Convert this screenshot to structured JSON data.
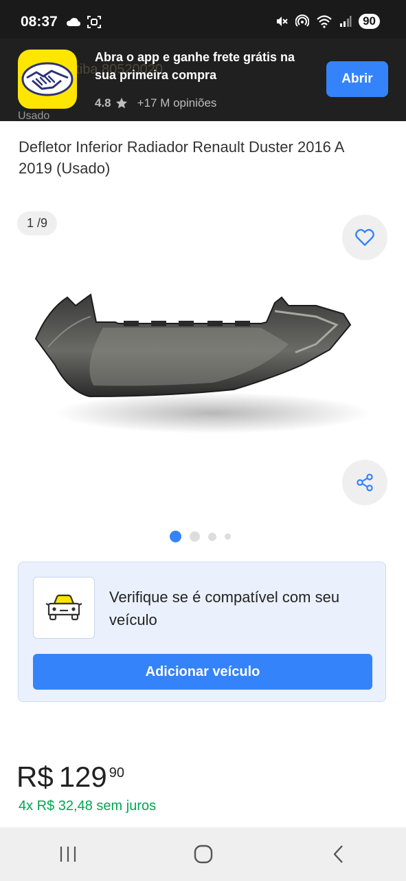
{
  "status_bar": {
    "time": "08:37",
    "battery": "90",
    "icons": [
      "cloud-icon",
      "screenshot-icon",
      "mute-icon",
      "hotspot-icon",
      "wifi-icon",
      "signal-icon"
    ]
  },
  "app_banner": {
    "title": "Abra o app e ganhe frete grátis na sua primeira compra",
    "rating": "4.8",
    "reviews": "+17 M opiniões",
    "open_label": "Abrir",
    "background_text": "para Curitiba 80520020"
  },
  "product": {
    "condition": "Usado",
    "title": "Defletor Inferior Radiador Renault Duster 2016 A 2019 (Usado)",
    "image_counter": "1 /9",
    "dots_count": 4,
    "active_dot": 0
  },
  "compat": {
    "text": "Verifique se é compatível com seu veículo",
    "button_label": "Adicionar veículo"
  },
  "price": {
    "currency": "R$",
    "amount": "129",
    "cents": "90",
    "installments": "4x R$ 32,48 sem juros"
  },
  "colors": {
    "accent": "#3483fa",
    "brand_yellow": "#ffe600",
    "installments_green": "#00a650"
  }
}
